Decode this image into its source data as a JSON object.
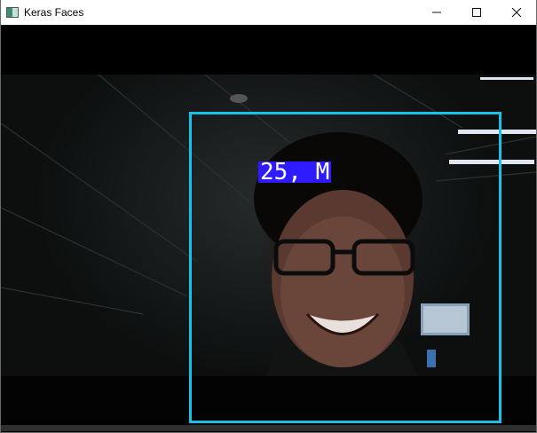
{
  "window": {
    "title": "Keras Faces",
    "icon": "opencv-window-icon"
  },
  "controls": {
    "minimize_icon": "minimize-icon",
    "maximize_icon": "maximize-icon",
    "close_icon": "close-icon"
  },
  "detection": {
    "label": "25, M",
    "box_color": "#16c2e8",
    "label_bg_color": "#2e1cff"
  }
}
